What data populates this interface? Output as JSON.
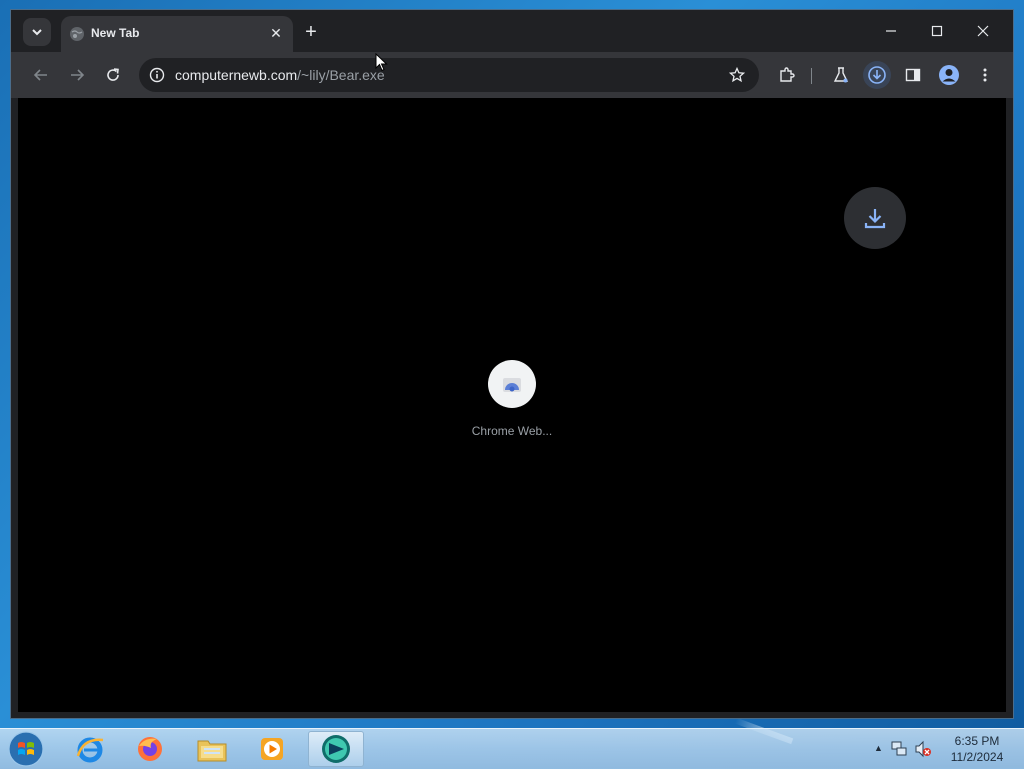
{
  "browser": {
    "tab": {
      "title": "New Tab",
      "close_symbol": "✕"
    },
    "new_tab_symbol": "+",
    "window_controls": {
      "minimize": "minimize",
      "maximize": "maximize",
      "close": "close"
    },
    "omnibox": {
      "url_host": "computernewb.com",
      "url_path": "/~lily/Bear.exe"
    },
    "shortcut": {
      "label": "Chrome Web..."
    }
  },
  "taskbar": {
    "apps": [
      "internet-explorer",
      "firefox",
      "file-explorer",
      "media-player",
      "chrome-app"
    ],
    "clock": {
      "time": "6:35 PM",
      "date": "11/2/2024"
    }
  },
  "colors": {
    "toolbar": "#35363a",
    "titlebar": "#202124",
    "content_bg": "#000000",
    "download_accent": "#8ab4f8"
  }
}
